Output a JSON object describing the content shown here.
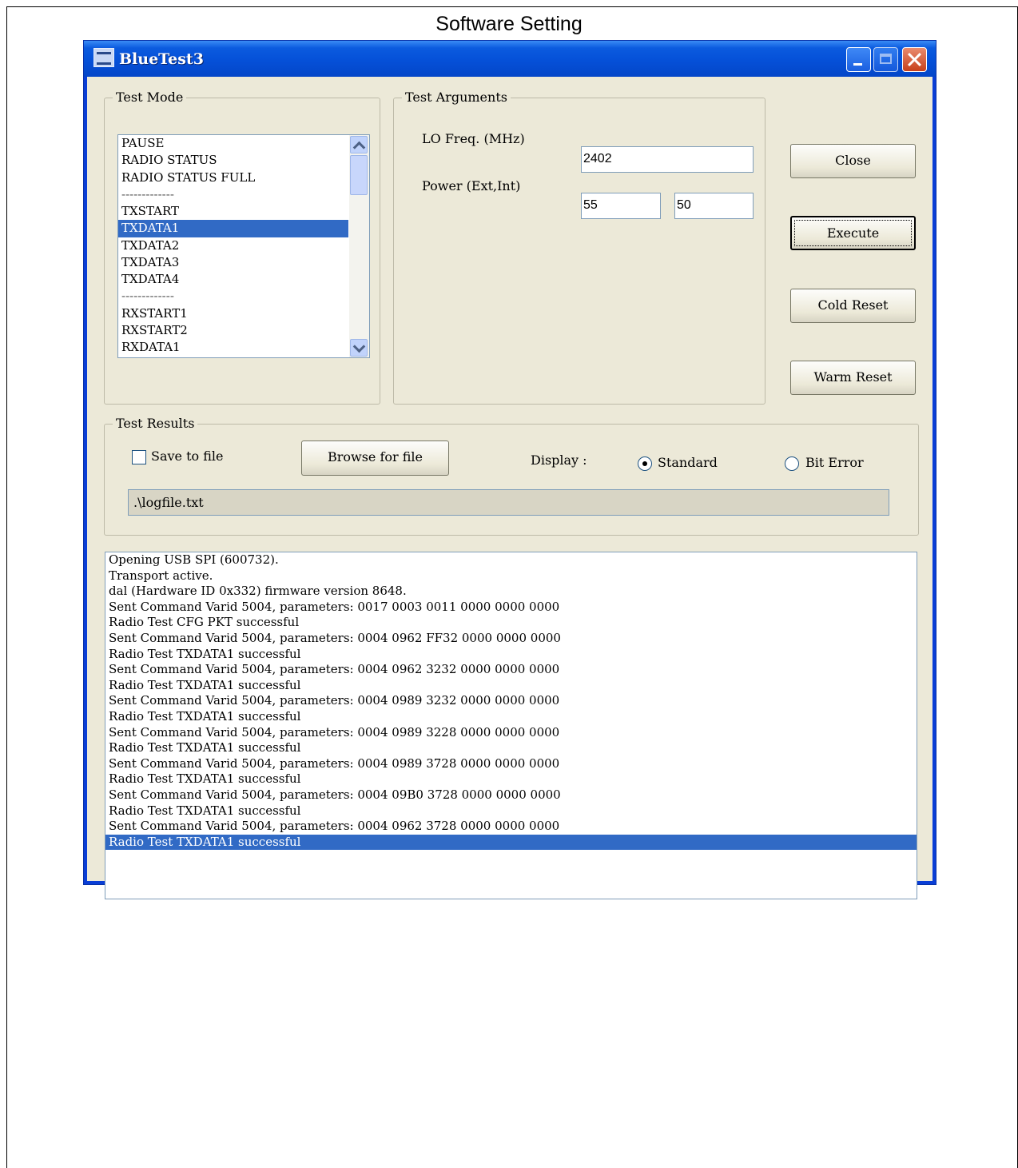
{
  "page": {
    "heading": "Software Setting"
  },
  "window": {
    "title": "BlueTest3"
  },
  "test_mode": {
    "label": "Test Mode",
    "items": [
      "PAUSE",
      "RADIO STATUS",
      "RADIO STATUS FULL",
      "-------------",
      "TXSTART",
      "TXDATA1",
      "TXDATA2",
      "TXDATA3",
      "TXDATA4",
      "-------------",
      "RXSTART1",
      "RXSTART2",
      "RXDATA1"
    ],
    "selected": "TXDATA1"
  },
  "test_arguments": {
    "label": "Test Arguments",
    "lo_freq_label": "LO Freq. (MHz)",
    "lo_freq_value": "2402",
    "power_label": "Power (Ext,Int)",
    "power_ext_value": "55",
    "power_int_value": "50"
  },
  "buttons": {
    "close": "Close",
    "execute": "Execute",
    "cold_reset": "Cold Reset",
    "warm_reset": "Warm Reset"
  },
  "test_results": {
    "label": "Test Results",
    "save_to_file_label": "Save to file",
    "save_to_file_checked": false,
    "browse_label": "Browse for file",
    "display_label": "Display :",
    "standard_label": "Standard",
    "bit_error_label": "Bit Error",
    "display_selected": "Standard",
    "file_path": ".\\logfile.txt"
  },
  "log": {
    "lines": [
      "Opening USB SPI (600732).",
      "Transport active.",
      "dal (Hardware ID 0x332) firmware version 8648.",
      "Sent Command Varid 5004, parameters: 0017 0003 0011 0000 0000 0000",
      "Radio Test CFG PKT successful",
      "Sent Command Varid 5004, parameters: 0004 0962 FF32 0000 0000 0000",
      "Radio Test TXDATA1 successful",
      "Sent Command Varid 5004, parameters: 0004 0962 3232 0000 0000 0000",
      "Radio Test TXDATA1 successful",
      "Sent Command Varid 5004, parameters: 0004 0989 3232 0000 0000 0000",
      "Radio Test TXDATA1 successful",
      "Sent Command Varid 5004, parameters: 0004 0989 3228 0000 0000 0000",
      "Radio Test TXDATA1 successful",
      "Sent Command Varid 5004, parameters: 0004 0989 3728 0000 0000 0000",
      "Radio Test TXDATA1 successful",
      "Sent Command Varid 5004, parameters: 0004 09B0 3728 0000 0000 0000",
      "Radio Test TXDATA1 successful",
      "Sent Command Varid 5004, parameters: 0004 0962 3728 0000 0000 0000",
      "Radio Test TXDATA1 successful"
    ],
    "selected_index": 18
  },
  "colors": {
    "titlebar": "#0550d8",
    "face": "#ece9d8",
    "selection": "#316ac5"
  }
}
